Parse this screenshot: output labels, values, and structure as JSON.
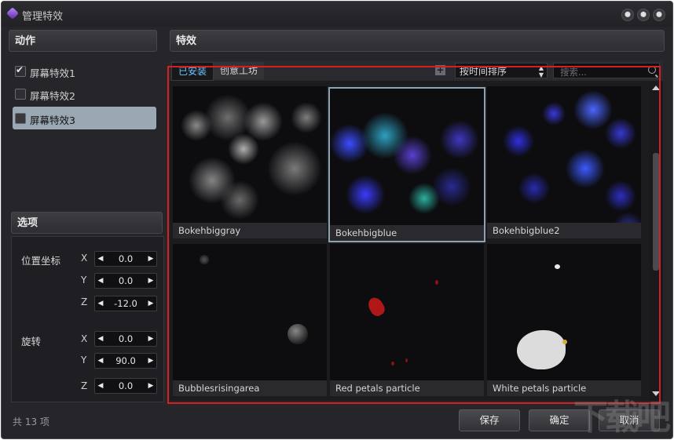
{
  "window": {
    "title": "管理特效"
  },
  "actions": {
    "header": "动作",
    "items": [
      {
        "label": "屏幕特效1",
        "checked": true,
        "selected": false
      },
      {
        "label": "屏幕特效2",
        "checked": false,
        "selected": false
      },
      {
        "label": "屏幕特效3",
        "checked": false,
        "selected": true
      }
    ]
  },
  "options": {
    "header": "选项",
    "position": {
      "label": "位置坐标",
      "x": "0.0",
      "y": "0.0",
      "z": "-12.0"
    },
    "rotation": {
      "label": "旋转",
      "x": "0.0",
      "y": "90.0",
      "z": "0.0"
    },
    "axes": {
      "x": "X",
      "y": "Y",
      "z": "Z"
    }
  },
  "effects": {
    "header": "特效",
    "tabs": [
      {
        "label": "已安装",
        "active": true
      },
      {
        "label": "创意工坊",
        "active": false
      }
    ],
    "sort": {
      "value": "按时间排序"
    },
    "search": {
      "placeholder": "搜索..."
    },
    "items": [
      {
        "name": "Bokehbiggray",
        "selected": false
      },
      {
        "name": "Bokehbigblue",
        "selected": true
      },
      {
        "name": "Bokehbigblue2",
        "selected": false
      },
      {
        "name": "Bubblesrisingarea",
        "selected": false
      },
      {
        "name": "Red petals particle",
        "selected": false
      },
      {
        "name": "White petals particle",
        "selected": false
      }
    ]
  },
  "footer": {
    "count": "共 13 项",
    "save": "保存",
    "ok": "确定",
    "cancel": "取消"
  },
  "watermark": "下载吧",
  "colors": {
    "highlight": "#d42020",
    "active_tab": "#6cc6ff",
    "selected_item": "#9aa8b4"
  }
}
